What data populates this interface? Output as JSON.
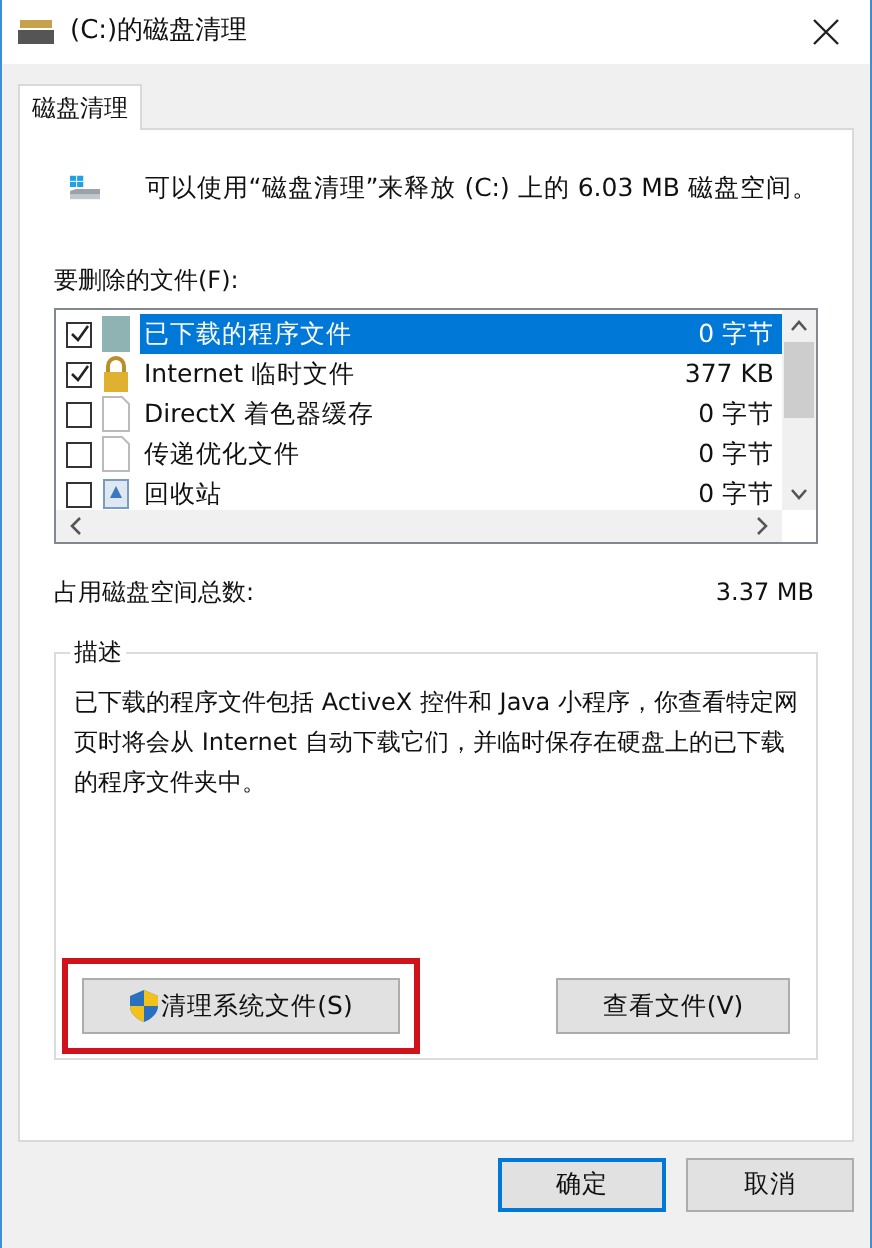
{
  "window": {
    "title": "(C:)的磁盘清理"
  },
  "tabs": [
    {
      "label": "磁盘清理",
      "selected": true
    }
  ],
  "summary": "可以使用“磁盘清理”来释放  (C:) 上的 6.03 MB 磁盘空间。",
  "files_label": "要删除的文件(F):",
  "files": [
    {
      "name": "已下载的程序文件",
      "size": "0 字节",
      "checked": true,
      "selected": true,
      "kind": "folder"
    },
    {
      "name": "Internet 临时文件",
      "size": "377 KB",
      "checked": true,
      "selected": false,
      "kind": "lock"
    },
    {
      "name": "DirectX 着色器缓存",
      "size": "0 字节",
      "checked": false,
      "selected": false,
      "kind": "file"
    },
    {
      "name": "传递优化文件",
      "size": "0 字节",
      "checked": false,
      "selected": false,
      "kind": "file"
    },
    {
      "name": "回收站",
      "size": "0 字节",
      "checked": false,
      "selected": false,
      "kind": "bin"
    }
  ],
  "total": {
    "label": "占用磁盘空间总数:",
    "value": "3.37 MB"
  },
  "description": {
    "title": "描述",
    "text": "已下载的程序文件包括 ActiveX 控件和 Java 小程序，你查看特定网页时将会从 Internet 自动下载它们，并临时保存在硬盘上的已下载的程序文件夹中。"
  },
  "actions": [
    {
      "label": "清理系统文件(S)",
      "shield": true,
      "highlighted": true
    },
    {
      "label": "查看文件(V)",
      "shield": false,
      "highlighted": false
    }
  ],
  "buttons": [
    "确定",
    "取消"
  ]
}
